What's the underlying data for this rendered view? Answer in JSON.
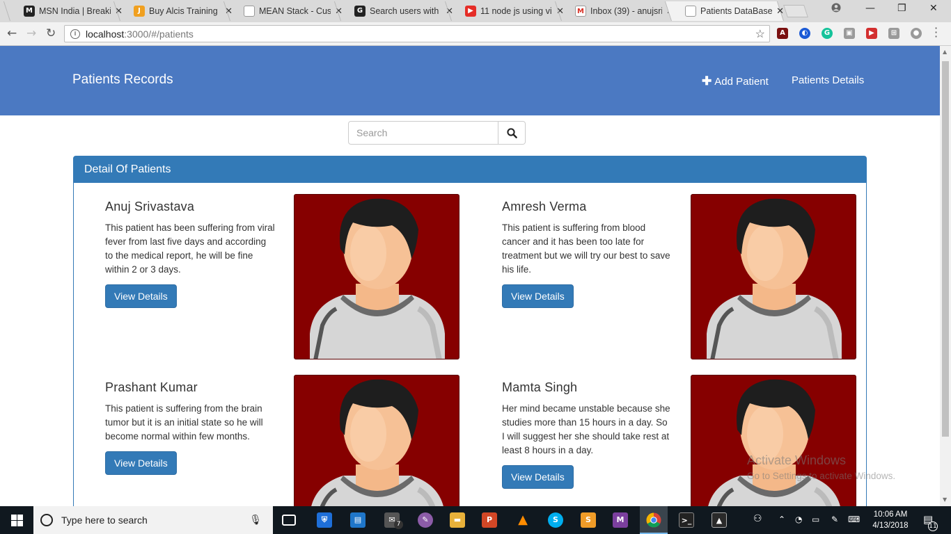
{
  "browser": {
    "tabs": [
      {
        "title": "MSN India | Breaking",
        "favicon_color": "#222222",
        "favicon_glyph": "M"
      },
      {
        "title": "Buy Alcis Training",
        "favicon_color": "#f0a020",
        "favicon_glyph": "J"
      },
      {
        "title": "MEAN Stack - Custo",
        "favicon_color": "#ffffff",
        "favicon_glyph": ""
      },
      {
        "title": "Search users with fi",
        "favicon_color": "#222222",
        "favicon_glyph": "G"
      },
      {
        "title": "11 node js using vi",
        "favicon_color": "#e52d27",
        "favicon_glyph": "▶"
      },
      {
        "title": "Inbox (39) - anujsri",
        "favicon_color": "#ffffff",
        "favicon_glyph": "M"
      },
      {
        "title": "Patients DataBase",
        "favicon_color": "#ffffff",
        "favicon_glyph": ""
      }
    ],
    "active_tab_index": 6,
    "close_glyph": "✕",
    "url_host": "localhost",
    "url_path": ":3000/#/patients"
  },
  "app": {
    "brand": "Patients Records",
    "nav_add": "Add Patient",
    "nav_details": "Patients Details",
    "search_placeholder": "Search",
    "panel_title": "Detail Of Patients",
    "button_label": "View Details",
    "patients": [
      {
        "name": "Anuj Srivastava",
        "description": "This patient has been suffering from viral fever from last five days and according to the medical report, he will be fine within 2 or 3 days."
      },
      {
        "name": "Amresh Verma",
        "description": "This patient is suffering from blood cancer and it has been too late for treatment but we will try our best to save his life."
      },
      {
        "name": "Prashant Kumar",
        "description": "This patient is suffering from the brain tumor but it is an initial state so he will become normal within few months."
      },
      {
        "name": "Mamta Singh",
        "description": "Her mind became unstable because she studies more than 15 hours in a day. So I will suggest her she should take rest at least 8 hours in a day."
      }
    ],
    "colors": {
      "navbar": "#4b79c2",
      "panel": "#337ab7",
      "avatar_bg": "#860000"
    }
  },
  "watermark": {
    "line1": "Activate Windows",
    "line2": "Go to Settings to activate Windows."
  },
  "taskbar": {
    "search_placeholder": "Type here to search",
    "time": "10:06 AM",
    "date": "4/13/2018",
    "mail_badge": "7",
    "notification_count": "11"
  }
}
